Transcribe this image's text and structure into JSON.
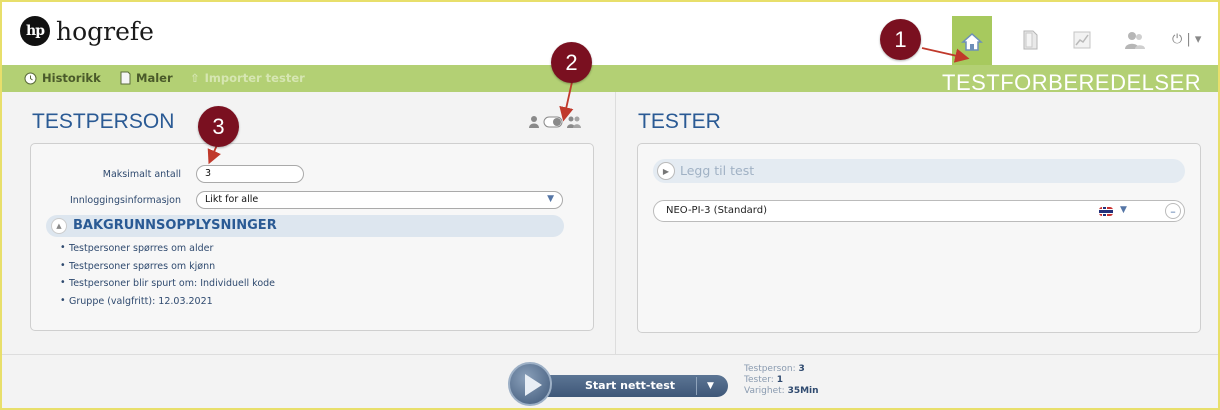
{
  "header": {
    "logo_mark": "hp",
    "logo_text": "hogrefe",
    "nav_icons": [
      "home-icon",
      "document-icon",
      "chart-icon",
      "users-icon"
    ],
    "power_label": "⏻ | ▾"
  },
  "toolbar": {
    "historikk": "Historikk",
    "maler": "Maler",
    "importer": "Importer tester",
    "section_title": "TESTFORBEREDELSER"
  },
  "testperson": {
    "title": "TESTPERSON",
    "max_label": "Maksimalt antall",
    "max_value": "3",
    "login_label": "Innloggingsinformasjon",
    "login_value": "Likt for alle",
    "background_title": "BAKGRUNNSOPPLYSNINGER",
    "bullets": [
      "Testpersoner spørres om alder",
      "Testpersoner spørres om kjønn",
      "Testpersoner blir spurt om: Individuell kode",
      "Gruppe (valgfritt): 12.03.2021"
    ]
  },
  "tester": {
    "title": "TESTER",
    "add_label": "Legg til test",
    "tests": [
      {
        "name": "NEO-PI-3 (Standard)"
      }
    ]
  },
  "footer": {
    "start_label": "Start nett-test",
    "testperson_label": "Testperson:",
    "testperson_value": "3",
    "tester_label": "Tester:",
    "tester_value": "1",
    "varighet_label": "Varighet:",
    "varighet_value": "35Min"
  },
  "callouts": [
    "1",
    "2",
    "3"
  ],
  "colors": {
    "accent_green": "#b3d074",
    "title_blue": "#2a5a94",
    "callout_red": "#7a1020",
    "frame_yellow": "#e8df6b"
  }
}
